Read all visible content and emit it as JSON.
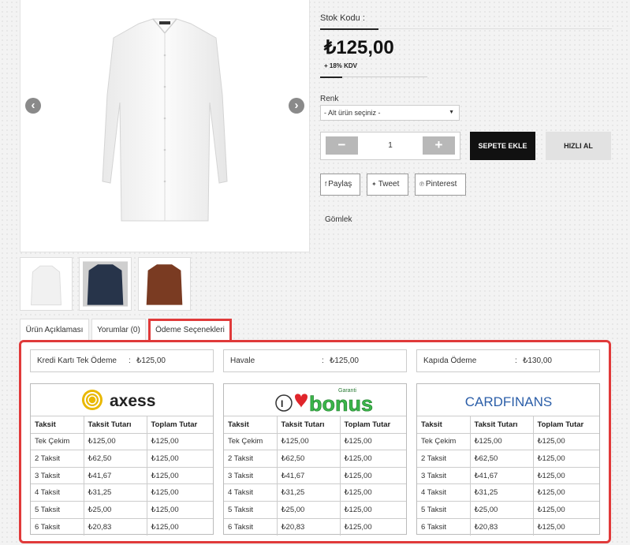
{
  "product": {
    "stock_label": "Stok Kodu :",
    "price": "₺125,00",
    "vat": "+ 18% KDV",
    "color_label": "Renk",
    "color_select_value": "- Alt ürün seçiniz -",
    "quantity": "1",
    "add_to_cart": "SEPETE EKLE",
    "quick_buy": "HIZLI AL",
    "category": "Gömlek"
  },
  "share": {
    "facebook": "Paylaş",
    "twitter": "Tweet",
    "pinterest": "Pinterest"
  },
  "tabs": [
    {
      "label": "Ürün Açıklaması"
    },
    {
      "label": "Yorumlar (0)"
    },
    {
      "label": "Ödeme Seçenekleri"
    }
  ],
  "payment_summary": [
    {
      "label": "Kredi Kartı Tek Ödeme",
      "sep": ":",
      "value": "₺125,00"
    },
    {
      "label": "Havale",
      "sep": ":",
      "value": "₺125,00"
    },
    {
      "label": "Kapıda Ödeme",
      "sep": ":",
      "value": "₺130,00"
    }
  ],
  "banks": [
    {
      "name": "axess",
      "headers": [
        "Taksit",
        "Taksit Tutarı",
        "Toplam Tutar"
      ],
      "rows": [
        [
          "Tek Çekim",
          "₺125,00",
          "₺125,00"
        ],
        [
          "2 Taksit",
          "₺62,50",
          "₺125,00"
        ],
        [
          "3 Taksit",
          "₺41,67",
          "₺125,00"
        ],
        [
          "4 Taksit",
          "₺31,25",
          "₺125,00"
        ],
        [
          "5 Taksit",
          "₺25,00",
          "₺125,00"
        ],
        [
          "6 Taksit",
          "₺20,83",
          "₺125,00"
        ]
      ]
    },
    {
      "name": "bonus",
      "brand_small": "Garanti",
      "headers": [
        "Taksit",
        "Taksit Tutarı",
        "Toplam Tutar"
      ],
      "rows": [
        [
          "Tek Çekim",
          "₺125,00",
          "₺125,00"
        ],
        [
          "2 Taksit",
          "₺62,50",
          "₺125,00"
        ],
        [
          "3 Taksit",
          "₺41,67",
          "₺125,00"
        ],
        [
          "4 Taksit",
          "₺31,25",
          "₺125,00"
        ],
        [
          "5 Taksit",
          "₺25,00",
          "₺125,00"
        ],
        [
          "6 Taksit",
          "₺20,83",
          "₺125,00"
        ]
      ]
    },
    {
      "name": "CARDFINANS",
      "headers": [
        "Taksit",
        "Taksit Tutarı",
        "Toplam Tutar"
      ],
      "rows": [
        [
          "Tek Çekim",
          "₺125,00",
          "₺125,00"
        ],
        [
          "2 Taksit",
          "₺62,50",
          "₺125,00"
        ],
        [
          "3 Taksit",
          "₺41,67",
          "₺125,00"
        ],
        [
          "4 Taksit",
          "₺31,25",
          "₺125,00"
        ],
        [
          "5 Taksit",
          "₺25,00",
          "₺125,00"
        ],
        [
          "6 Taksit",
          "₺20,83",
          "₺125,00"
        ]
      ]
    }
  ],
  "colors": {
    "highlight_border": "#e03a3a",
    "add_button_bg": "#111111",
    "quick_button_bg": "#e2e2e2",
    "axess_yellow": "#e9b800",
    "bonus_green": "#3bb54a",
    "cardfinans_blue": "#2b5ea8"
  }
}
